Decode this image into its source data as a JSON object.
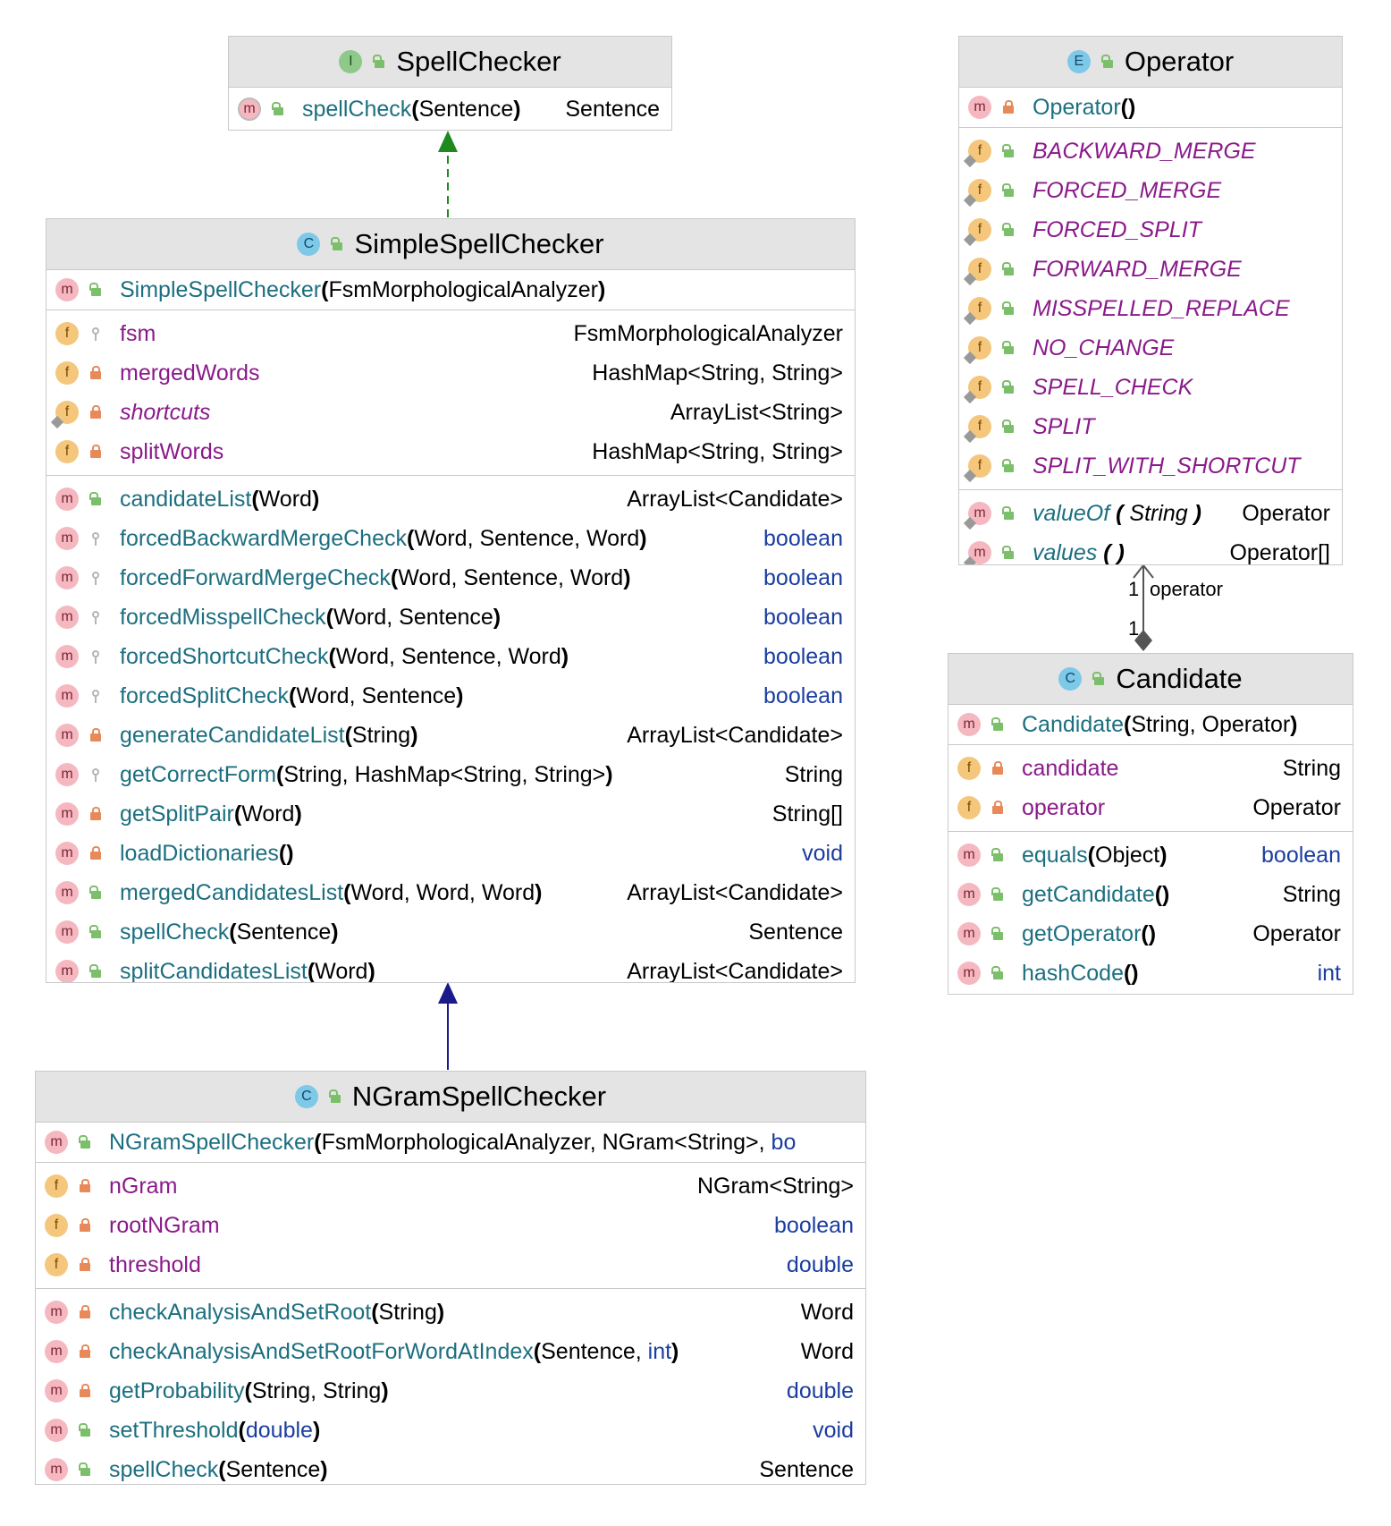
{
  "classes": {
    "spellchecker": {
      "kind": "I",
      "name": "SpellChecker",
      "methods": [
        {
          "name": "spellCheck",
          "params": "Sentence",
          "type": "Sentence"
        }
      ]
    },
    "simplespellchecker": {
      "kind": "C",
      "name": "SimpleSpellChecker",
      "constructor": {
        "name": "SimpleSpellChecker",
        "params": "FsmMorphologicalAnalyzer"
      },
      "fields": [
        {
          "name": "fsm",
          "type": "FsmMorphologicalAnalyzer"
        },
        {
          "name": "mergedWords",
          "type": "HashMap<String, String>"
        },
        {
          "name": "shortcuts",
          "type": "ArrayList<String>"
        },
        {
          "name": "splitWords",
          "type": "HashMap<String, String>"
        }
      ],
      "methods": [
        {
          "name": "candidateList",
          "params": "Word",
          "type": "ArrayList<Candidate>"
        },
        {
          "name": "forcedBackwardMergeCheck",
          "params": "Word, Sentence, Word",
          "type": "boolean"
        },
        {
          "name": "forcedForwardMergeCheck",
          "params": "Word, Sentence, Word",
          "type": "boolean"
        },
        {
          "name": "forcedMisspellCheck",
          "params": "Word, Sentence",
          "type": "boolean"
        },
        {
          "name": "forcedShortcutCheck",
          "params": "Word, Sentence, Word",
          "type": "boolean"
        },
        {
          "name": "forcedSplitCheck",
          "params": "Word, Sentence",
          "type": "boolean"
        },
        {
          "name": "generateCandidateList",
          "params": "String",
          "type": "ArrayList<Candidate>"
        },
        {
          "name": "getCorrectForm",
          "params": "String, HashMap<String, String>",
          "type": "String"
        },
        {
          "name": "getSplitPair",
          "params": "Word",
          "type": "String[]"
        },
        {
          "name": "loadDictionaries",
          "params": "",
          "type": "void"
        },
        {
          "name": "mergedCandidatesList",
          "params": "Word, Word, Word",
          "type": "ArrayList<Candidate>"
        },
        {
          "name": "spellCheck",
          "params": "Sentence",
          "type": "Sentence"
        },
        {
          "name": "splitCandidatesList",
          "params": "Word",
          "type": "ArrayList<Candidate>"
        }
      ]
    },
    "ngramspellchecker": {
      "kind": "C",
      "name": "NGramSpellChecker",
      "constructor": {
        "name": "NGramSpellChecker",
        "params": "FsmMorphologicalAnalyzer, NGram<String>, ",
        "params_trunc": "bo"
      },
      "fields": [
        {
          "name": "nGram",
          "type": "NGram<String>"
        },
        {
          "name": "rootNGram",
          "type": "boolean"
        },
        {
          "name": "threshold",
          "type": "double"
        }
      ],
      "methods": [
        {
          "name": "checkAnalysisAndSetRoot",
          "params": "String",
          "type": "Word"
        },
        {
          "name": "checkAnalysisAndSetRootForWordAtIndex",
          "params_a": "Sentence, ",
          "params_kw": "int",
          "type": "Word"
        },
        {
          "name": "getProbability",
          "params": "String, String",
          "type": "double"
        },
        {
          "name": "setThreshold",
          "params_kw": "double",
          "type": "void"
        },
        {
          "name": "spellCheck",
          "params": "Sentence",
          "type": "Sentence"
        }
      ]
    },
    "operator": {
      "kind": "E",
      "name": "Operator",
      "constructor": {
        "name": "Operator",
        "params": ""
      },
      "constants": [
        "BACKWARD_MERGE",
        "FORCED_MERGE",
        "FORCED_SPLIT",
        "FORWARD_MERGE",
        "MISSPELLED_REPLACE",
        "NO_CHANGE",
        "SPELL_CHECK",
        "SPLIT",
        "SPLIT_WITH_SHORTCUT"
      ],
      "methods": [
        {
          "name": "valueOf",
          "params": "String",
          "type": "Operator"
        },
        {
          "name": "values",
          "params": "",
          "type": "Operator[]"
        }
      ]
    },
    "candidate": {
      "kind": "C",
      "name": "Candidate",
      "constructor": {
        "name": "Candidate",
        "params": "String, Operator"
      },
      "fields": [
        {
          "name": "candidate",
          "type": "String"
        },
        {
          "name": "operator",
          "type": "Operator"
        }
      ],
      "methods": [
        {
          "name": "equals",
          "params": "Object",
          "type": "boolean"
        },
        {
          "name": "getCandidate",
          "params": "",
          "type": "String"
        },
        {
          "name": "getOperator",
          "params": "",
          "type": "Operator"
        },
        {
          "name": "hashCode",
          "params": "",
          "type": "int"
        }
      ]
    }
  },
  "association": {
    "label": "operator",
    "mult_top": "1",
    "mult_bottom": "1"
  },
  "badges": {
    "m": "m",
    "f": "f",
    "c": "c",
    "i": "I",
    "e": "E"
  },
  "colors": {
    "realization": "#1e8a1e",
    "inheritance": "#1a1a8a",
    "association": "#555555"
  }
}
